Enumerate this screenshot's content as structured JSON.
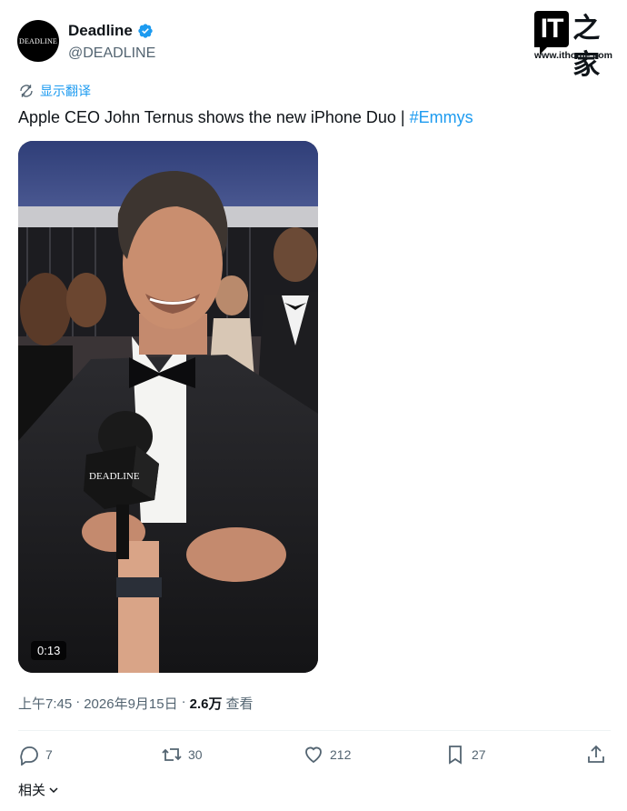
{
  "account": {
    "avatar_text": "DEADLINE",
    "display_name": "Deadline",
    "handle": "@DEADLINE",
    "verified_icon": "verified-badge-icon"
  },
  "watermark": {
    "logo_latin": "IT",
    "logo_cjk": "之家",
    "url": "www.ithome.com"
  },
  "translate": {
    "label": "显示翻译",
    "icon": "translate-icon"
  },
  "tweet": {
    "text": "Apple CEO John Ternus shows the new iPhone Duo | ",
    "hashtag": "#Emmys"
  },
  "media": {
    "duration": "0:13",
    "mic_flag_text": "DEADLINE"
  },
  "meta": {
    "time": "上午7:45",
    "sep": "·",
    "date": "2026年9月15日",
    "views_count": "2.6万",
    "views_label": "查看"
  },
  "actions": {
    "reply": {
      "icon": "reply-icon",
      "count": "7"
    },
    "repost": {
      "icon": "repost-icon",
      "count": "30"
    },
    "like": {
      "icon": "heart-icon",
      "count": "212"
    },
    "bookmark": {
      "icon": "bookmark-icon",
      "count": "27"
    },
    "share": {
      "icon": "share-icon"
    }
  },
  "related": {
    "label": "相关"
  },
  "colors": {
    "accent": "#1d9bf0",
    "muted": "#536471",
    "text": "#0f1419"
  }
}
